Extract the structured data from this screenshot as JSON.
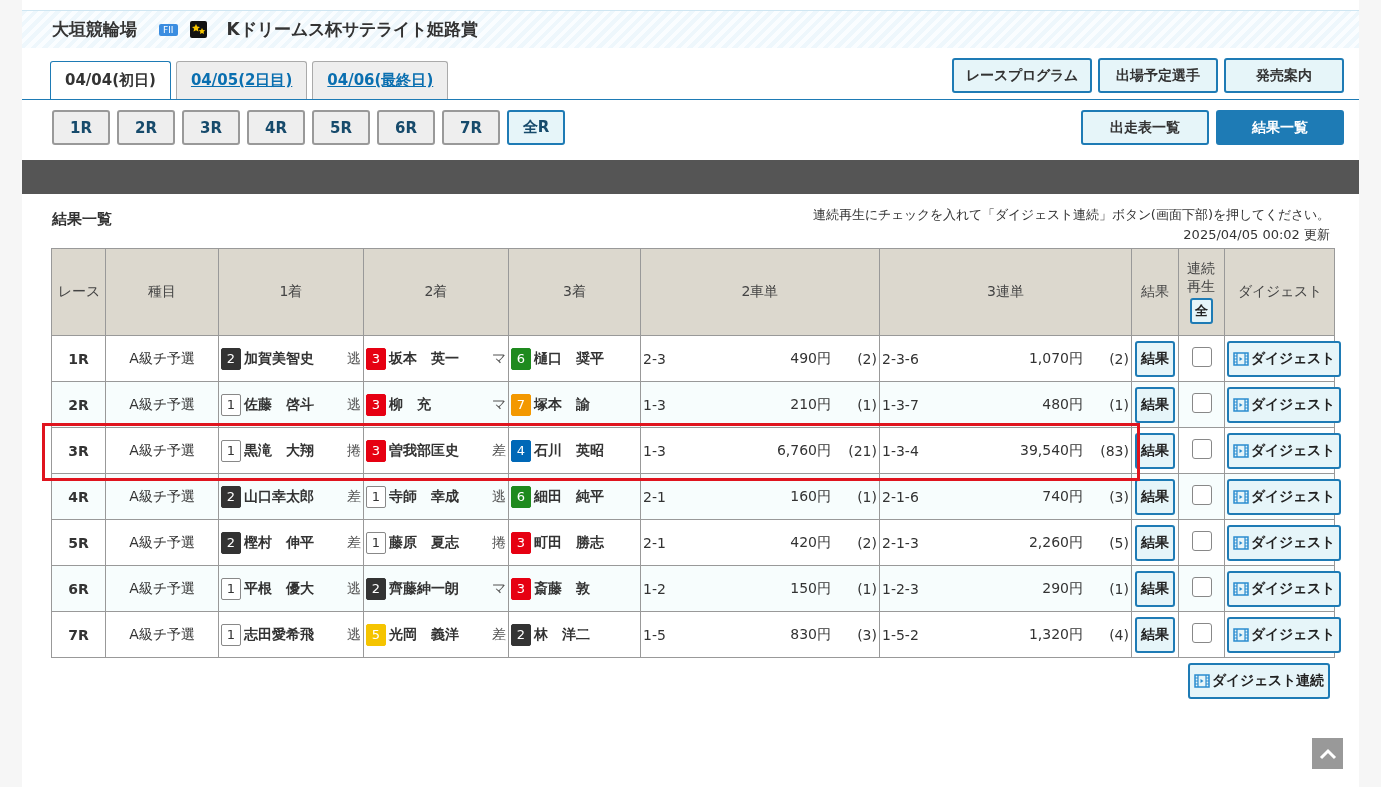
{
  "header": {
    "venue": "大垣競輪場",
    "grade": "FII",
    "race_title": "Kドリームス杯サテライト姫路賞"
  },
  "day_tabs": [
    {
      "label": "04/04(初日)",
      "selected": true
    },
    {
      "label": "04/05(2日目)",
      "selected": false
    },
    {
      "label": "04/06(最終日)",
      "selected": false
    }
  ],
  "top_links": [
    "レースプログラム",
    "出場予定選手",
    "発売案内"
  ],
  "race_buttons": [
    {
      "label": "1R",
      "selected": false
    },
    {
      "label": "2R",
      "selected": false
    },
    {
      "label": "3R",
      "selected": false
    },
    {
      "label": "4R",
      "selected": false
    },
    {
      "label": "5R",
      "selected": false
    },
    {
      "label": "6R",
      "selected": false
    },
    {
      "label": "7R",
      "selected": false
    },
    {
      "label": "全R",
      "selected": true
    }
  ],
  "view_buttons": [
    {
      "label": "出走表一覧",
      "selected": false
    },
    {
      "label": "結果一覧",
      "selected": true
    }
  ],
  "section_title": "結果一覧",
  "instruction": "連続再生にチェックを入れて「ダイジェスト連続」ボタン(画面下部)を押してください。",
  "updated": "2025/04/05 00:02 更新",
  "table": {
    "columns": [
      "レース",
      "種目",
      "1着",
      "2着",
      "3着",
      "2車単",
      "3連単",
      "結果",
      "連続再生",
      "ダイジェスト"
    ],
    "select_all": "全",
    "rows": [
      {
        "race": "1R",
        "event": "A級チ予選",
        "highlighted": false,
        "finishers": [
          {
            "number": "2",
            "color": "#333333",
            "name": "加賀美智史",
            "tactic": "逃"
          },
          {
            "number": "3",
            "color": "#e60012",
            "name": "坂本　英一",
            "tactic": "マ"
          },
          {
            "number": "6",
            "color": "#1e8a1e",
            "name": "樋口　奨平"
          }
        ],
        "exacta": [
          "2-3",
          "490円",
          "(2)"
        ],
        "trifecta": [
          "2-3-6",
          "1,070円",
          "(2)"
        ],
        "result": "結果",
        "checked": false,
        "digest": "ダイジェスト"
      },
      {
        "race": "2R",
        "event": "A級チ予選",
        "highlighted": false,
        "finishers": [
          {
            "number": "1",
            "color": "#ffffff",
            "name": "佐藤　啓斗",
            "tactic": "逃"
          },
          {
            "number": "3",
            "color": "#e60012",
            "name": "柳　充",
            "tactic": "マ"
          },
          {
            "number": "7",
            "color": "#f39800",
            "name": "塚本　諭"
          }
        ],
        "exacta": [
          "1-3",
          "210円",
          "(1)"
        ],
        "trifecta": [
          "1-3-7",
          "480円",
          "(1)"
        ],
        "result": "結果",
        "checked": false,
        "digest": "ダイジェスト"
      },
      {
        "race": "3R",
        "event": "A級チ予選",
        "highlighted": true,
        "finishers": [
          {
            "number": "1",
            "color": "#ffffff",
            "name": "黒滝　大翔",
            "tactic": "捲"
          },
          {
            "number": "3",
            "color": "#e60012",
            "name": "曽我部匡史",
            "tactic": "差"
          },
          {
            "number": "4",
            "color": "#0068b7",
            "name": "石川　英昭"
          }
        ],
        "exacta": [
          "1-3",
          "6,760円",
          "(21)"
        ],
        "trifecta": [
          "1-3-4",
          "39,540円",
          "(83)"
        ],
        "result": "結果",
        "checked": false,
        "digest": "ダイジェスト"
      },
      {
        "race": "4R",
        "event": "A級チ予選",
        "highlighted": false,
        "finishers": [
          {
            "number": "2",
            "color": "#333333",
            "name": "山口幸太郎",
            "tactic": "差"
          },
          {
            "number": "1",
            "color": "#ffffff",
            "name": "寺師　幸成",
            "tactic": "逃"
          },
          {
            "number": "6",
            "color": "#1e8a1e",
            "name": "細田　純平"
          }
        ],
        "exacta": [
          "2-1",
          "160円",
          "(1)"
        ],
        "trifecta": [
          "2-1-6",
          "740円",
          "(3)"
        ],
        "result": "結果",
        "checked": false,
        "digest": "ダイジェスト"
      },
      {
        "race": "5R",
        "event": "A級チ予選",
        "highlighted": false,
        "finishers": [
          {
            "number": "2",
            "color": "#333333",
            "name": "樫村　伸平",
            "tactic": "差"
          },
          {
            "number": "1",
            "color": "#ffffff",
            "name": "藤原　夏志",
            "tactic": "捲"
          },
          {
            "number": "3",
            "color": "#e60012",
            "name": "町田　勝志"
          }
        ],
        "exacta": [
          "2-1",
          "420円",
          "(2)"
        ],
        "trifecta": [
          "2-1-3",
          "2,260円",
          "(5)"
        ],
        "result": "結果",
        "checked": false,
        "digest": "ダイジェスト"
      },
      {
        "race": "6R",
        "event": "A級チ予選",
        "highlighted": false,
        "finishers": [
          {
            "number": "1",
            "color": "#ffffff",
            "name": "平根　優大",
            "tactic": "逃"
          },
          {
            "number": "2",
            "color": "#333333",
            "name": "齊藤紳一朗",
            "tactic": "マ"
          },
          {
            "number": "3",
            "color": "#e60012",
            "name": "斎藤　敦"
          }
        ],
        "exacta": [
          "1-2",
          "150円",
          "(1)"
        ],
        "trifecta": [
          "1-2-3",
          "290円",
          "(1)"
        ],
        "result": "結果",
        "checked": false,
        "digest": "ダイジェスト"
      },
      {
        "race": "7R",
        "event": "A級チ予選",
        "highlighted": false,
        "finishers": [
          {
            "number": "1",
            "color": "#ffffff",
            "name": "志田愛希飛",
            "tactic": "逃"
          },
          {
            "number": "5",
            "color": "#f5c400",
            "name": "光岡　義洋",
            "tactic": "差"
          },
          {
            "number": "2",
            "color": "#333333",
            "name": "林　洋二"
          }
        ],
        "exacta": [
          "1-5",
          "830円",
          "(3)"
        ],
        "trifecta": [
          "1-5-2",
          "1,320円",
          "(4)"
        ],
        "result": "結果",
        "checked": false,
        "digest": "ダイジェスト"
      }
    ]
  },
  "digest_all": "ダイジェスト連続"
}
